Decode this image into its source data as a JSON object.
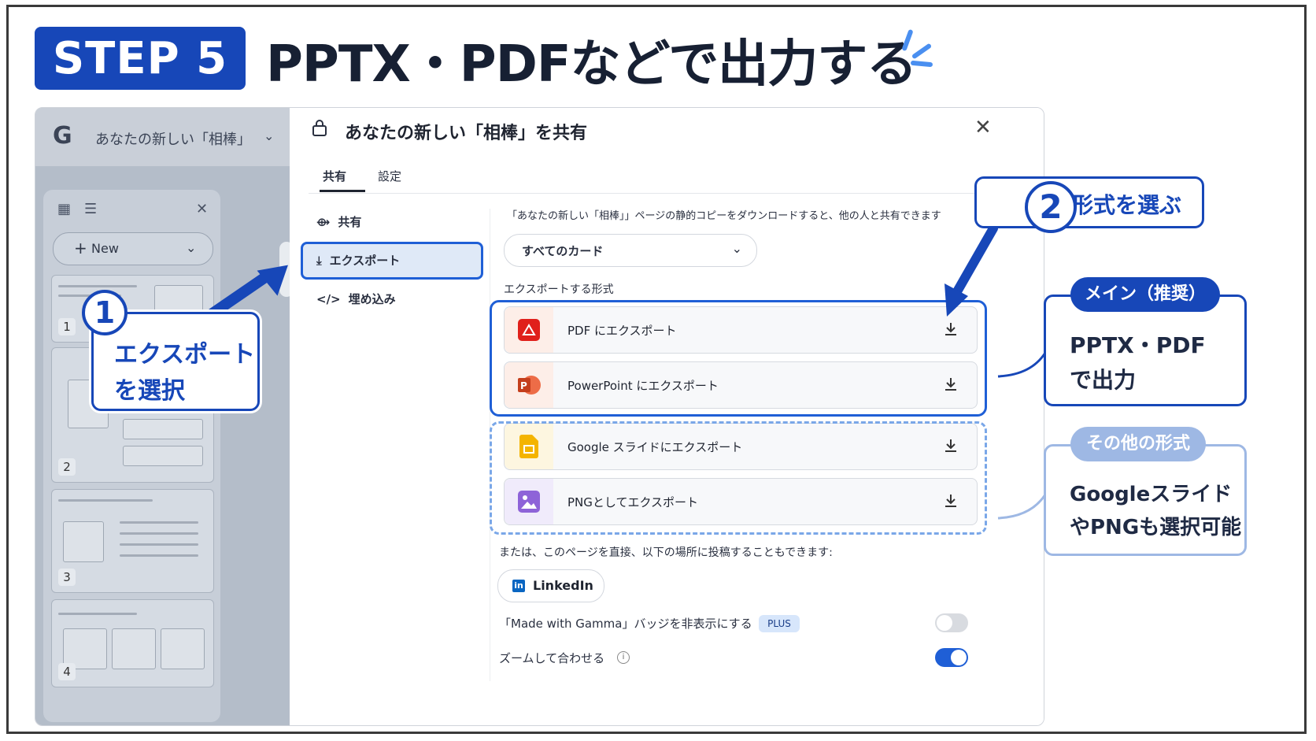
{
  "header": {
    "step_label": "STEP 5",
    "title": "PPTX・PDFなどで出力する"
  },
  "app": {
    "logo_letter": "G",
    "doc_title": "あなたの新しい「相棒」",
    "new_button": "New",
    "thumb_numbers": [
      "1",
      "2",
      "3",
      "4"
    ]
  },
  "modal": {
    "title": "あなたの新しい「相棒」を共有",
    "tabs": [
      "共有",
      "設定"
    ],
    "nav": {
      "share": "共有",
      "export": "エクスポート",
      "embed": "埋め込み"
    },
    "description": "「あなたの新しい「相棒」」ページの静的コピーをダウンロードすると、他の人と共有できます",
    "dropdown_value": "すべてのカード",
    "format_label": "エクスポートする形式",
    "exports": [
      "PDF にエクスポート",
      "PowerPoint にエクスポート",
      "Google スライドにエクスポート",
      "PNGとしてエクスポート"
    ],
    "or_text": "または、このページを直接、以下の場所に投稿することもできます:",
    "linkedin": "LinkedIn",
    "linkedin_icon_text": "in",
    "badge_toggle_label": "「Made with Gamma」バッジを非表示にする",
    "plus_badge": "PLUS",
    "zoom_label": "ズームして合わせる",
    "badge_toggle_on": false,
    "zoom_toggle_on": true
  },
  "callouts": {
    "c1_num": "1",
    "c1_line1": "エクスポート",
    "c1_line2": "を選択",
    "c2_num": "2",
    "c2_text": "出力形式を選ぶ",
    "main_tag": "メイン（推奨）",
    "main_line1": "PPTX・PDF",
    "main_line2": "で出力",
    "other_tag": "その他の形式",
    "other_line1": "Googleスライド",
    "other_line2": "やPNGも選択可能"
  },
  "colors": {
    "primary": "#1747b8",
    "accent_blue": "#1f5fd6",
    "dashed_blue": "#7aa7e8",
    "pdf_red": "#e0201b",
    "ppt_orange": "#d24726",
    "slides_yellow": "#f4b400",
    "png_purple": "#8e63d8"
  }
}
